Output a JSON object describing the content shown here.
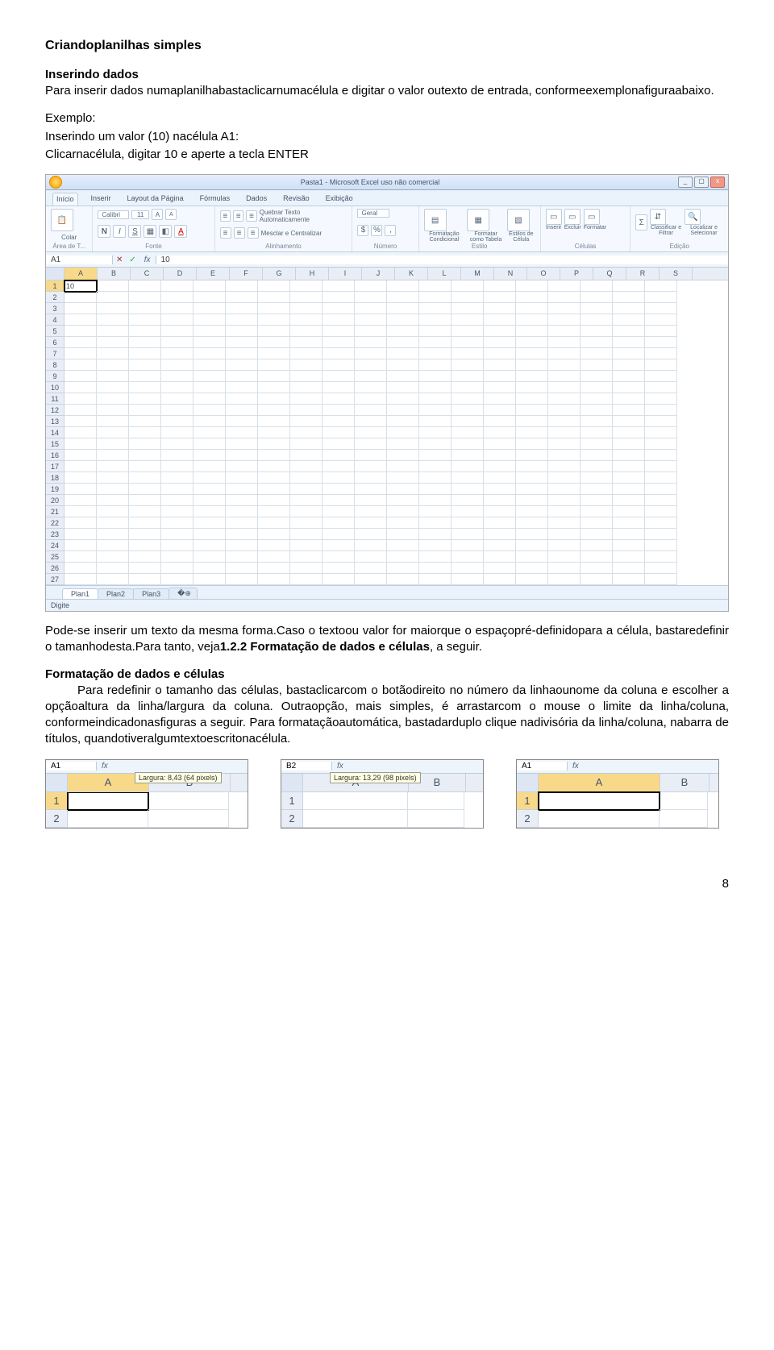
{
  "headings": {
    "h1": "Criandoplanilhas simples",
    "h2a": "Inserindo dados",
    "h2b": "Formatação de dados e células"
  },
  "para": {
    "p1": "Para inserir dados numaplanilhabastaclicarnumacélula e digitar o valor outexto de entrada, conformeexemplonafiguraabaixo.",
    "p2a": "Exemplo:",
    "p2b": "Inserindo um valor (10) nacélula A1:",
    "p2c": "Clicarnacélula, digitar 10 e aperte a tecla ENTER",
    "p3a": "Pode-se inserir um texto da mesma forma.Caso o textoou valor for maiorque o espaçopré-definidopara a célula, bastaredefinir o tamanhodesta.Para tanto, veja",
    "p3b": "1.2.2 Formatação de dados e células",
    "p3c": ", a seguir.",
    "p4": "Para redefinir o tamanho das células, bastaclicarcom o botãodireito no número da linhaounome da coluna e escolher a opçãoaltura da linha/largura da coluna. Outraopção, mais simples, é arrastarcom o mouse o limite da linha/coluna, conformeindicadonasfiguras a seguir. Para formataçãoautomática, bastadarduplo clique nadivisória da linha/coluna, nabarra de títulos, quandotiveralgumtextoescritonacélula."
  },
  "excel": {
    "win_title": "Pasta1 - Microsoft Excel uso não comercial",
    "tabs": [
      "Início",
      "Inserir",
      "Layout da Página",
      "Fórmulas",
      "Dados",
      "Revisão",
      "Exibição"
    ],
    "groups": {
      "clipboard": "Área de T...",
      "font": "Fonte",
      "align": "Alinhamento",
      "number": "Número",
      "style": "Estilo",
      "cells": "Células",
      "edit": "Edição"
    },
    "font_name": "Calibri",
    "font_size": "11",
    "ribbon_labels": {
      "paste": "Colar",
      "wrap": "Quebrar Texto Automaticamente",
      "merge": "Mesclar e Centralizar",
      "general": "Geral",
      "cond": "Formatação Condicional",
      "table": "Formatar como Tabela",
      "cellstyle": "Estilos de Célula",
      "insert": "Inserir",
      "delete": "Excluir",
      "format": "Formatar",
      "sort": "Classificar e Filtrar",
      "find": "Localizar e Selecionar"
    },
    "namebox": "A1",
    "formula_val": "10",
    "cell_a1": "10",
    "columns": [
      "A",
      "B",
      "C",
      "D",
      "E",
      "F",
      "G",
      "H",
      "I",
      "J",
      "K",
      "L",
      "M",
      "N",
      "O",
      "P",
      "Q",
      "R",
      "S"
    ],
    "rows": [
      "1",
      "2",
      "3",
      "4",
      "5",
      "6",
      "7",
      "8",
      "9",
      "10",
      "11",
      "12",
      "13",
      "14",
      "15",
      "16",
      "17",
      "18",
      "19",
      "20",
      "21",
      "22",
      "23",
      "24",
      "25",
      "26",
      "27"
    ],
    "sheets": [
      "Plan1",
      "Plan2",
      "Plan3"
    ],
    "status": "Digite"
  },
  "thumbs": {
    "t1": {
      "namebox": "A1",
      "colA": "A",
      "colB": "B",
      "tip": "Largura: 8,43 (64 pixels)",
      "r1": "1",
      "r2": "2"
    },
    "t2": {
      "namebox": "B2",
      "colA": "A",
      "colB": "B",
      "tip": "Largura: 13,29 (98 pixels)",
      "r1": "1",
      "r2": "2"
    },
    "t3": {
      "namebox": "A1",
      "colA": "A",
      "colB": "B",
      "r1": "1",
      "r2": "2"
    }
  },
  "page_number": "8"
}
